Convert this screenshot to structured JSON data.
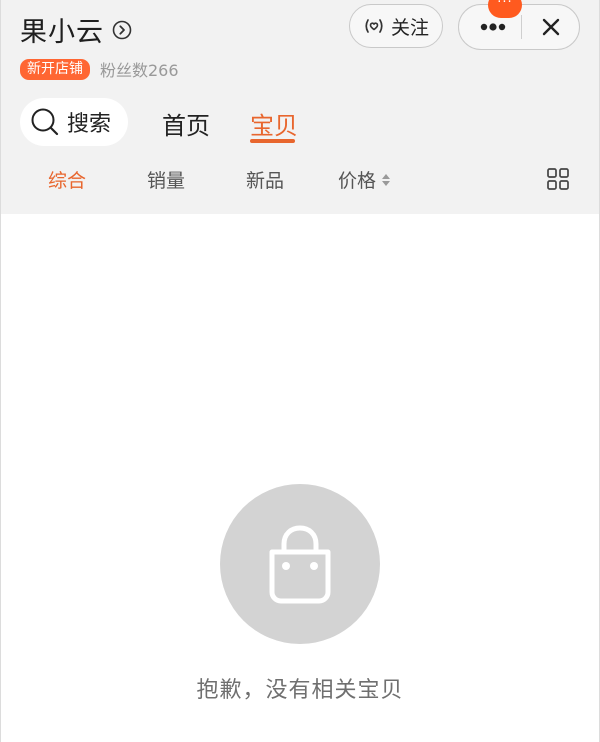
{
  "header": {
    "shop_name": "果小云",
    "new_badge": "新开店铺",
    "fans_label": "粉丝数266",
    "follow_label": "关注",
    "notif_text": "···"
  },
  "nav": {
    "search_label": "搜索",
    "tabs": [
      {
        "label": "首页"
      },
      {
        "label": "宝贝"
      }
    ],
    "active_tab": "宝贝"
  },
  "sort": {
    "items": [
      {
        "label": "综合"
      },
      {
        "label": "销量"
      },
      {
        "label": "新品"
      },
      {
        "label": "价格"
      }
    ],
    "active": "综合"
  },
  "empty_state": {
    "message": "抱歉，没有相关宝贝",
    "icon": "shopping-bag-icon"
  },
  "colors": {
    "accent": "#e8662e",
    "badge": "#ff6633",
    "header_bg": "#f2f2f2",
    "empty_circle": "#d3d3d3"
  }
}
